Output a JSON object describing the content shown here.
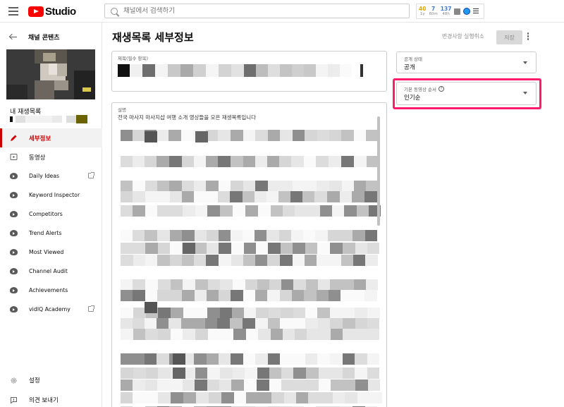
{
  "header": {
    "logo_text": "Studio",
    "search_placeholder": "채널에서 검색하기",
    "vidiq": {
      "stats": [
        {
          "value": "40",
          "label": "1y",
          "color": "#e6a800"
        },
        {
          "value": "7",
          "label": "60m",
          "color": "#3b7bd6"
        },
        {
          "value": "137",
          "label": "48h",
          "color": "#3b7bd6"
        }
      ]
    }
  },
  "sidebar": {
    "back_label": "채널 콘텐츠",
    "playlist_label": "내 재생목록",
    "items": [
      {
        "label": "세부정보",
        "icon": "pencil-icon",
        "active": true,
        "external": false
      },
      {
        "label": "동영상",
        "icon": "video-list-icon",
        "active": false,
        "external": false
      },
      {
        "label": "Daily Ideas",
        "icon": "vidiq-icon",
        "active": false,
        "external": true
      },
      {
        "label": "Keyword Inspector",
        "icon": "vidiq-icon",
        "active": false,
        "external": false
      },
      {
        "label": "Competitors",
        "icon": "vidiq-icon",
        "active": false,
        "external": false
      },
      {
        "label": "Trend Alerts",
        "icon": "vidiq-icon",
        "active": false,
        "external": false
      },
      {
        "label": "Most Viewed",
        "icon": "vidiq-icon",
        "active": false,
        "external": false
      },
      {
        "label": "Channel Audit",
        "icon": "vidiq-icon",
        "active": false,
        "external": false
      },
      {
        "label": "Achievements",
        "icon": "vidiq-icon",
        "active": false,
        "external": false
      },
      {
        "label": "vidIQ Academy",
        "icon": "vidiq-icon",
        "active": false,
        "external": true
      }
    ],
    "bottom_items": [
      {
        "label": "설정",
        "icon": "gear-icon"
      },
      {
        "label": "의견 보내기",
        "icon": "feedback-icon"
      }
    ]
  },
  "main": {
    "page_title": "재생목록 세부정보",
    "undo_label": "변경사항 실행취소",
    "save_label": "저장",
    "title_field_label": "제목(필수 항목)",
    "description_label": "설명",
    "description_first_line": "전국 마사지 마사지샵 여행 소개 영상들을 모은 재생목록입니다",
    "visibility": {
      "label": "공개 상태",
      "value": "공개"
    },
    "sort": {
      "label": "기본 동영상 순서",
      "help": "?",
      "value": "인기순"
    }
  },
  "colors": {
    "brand_red": "#ff0000",
    "active_red": "#cc0000",
    "highlight_pink": "#ff1a6c"
  }
}
